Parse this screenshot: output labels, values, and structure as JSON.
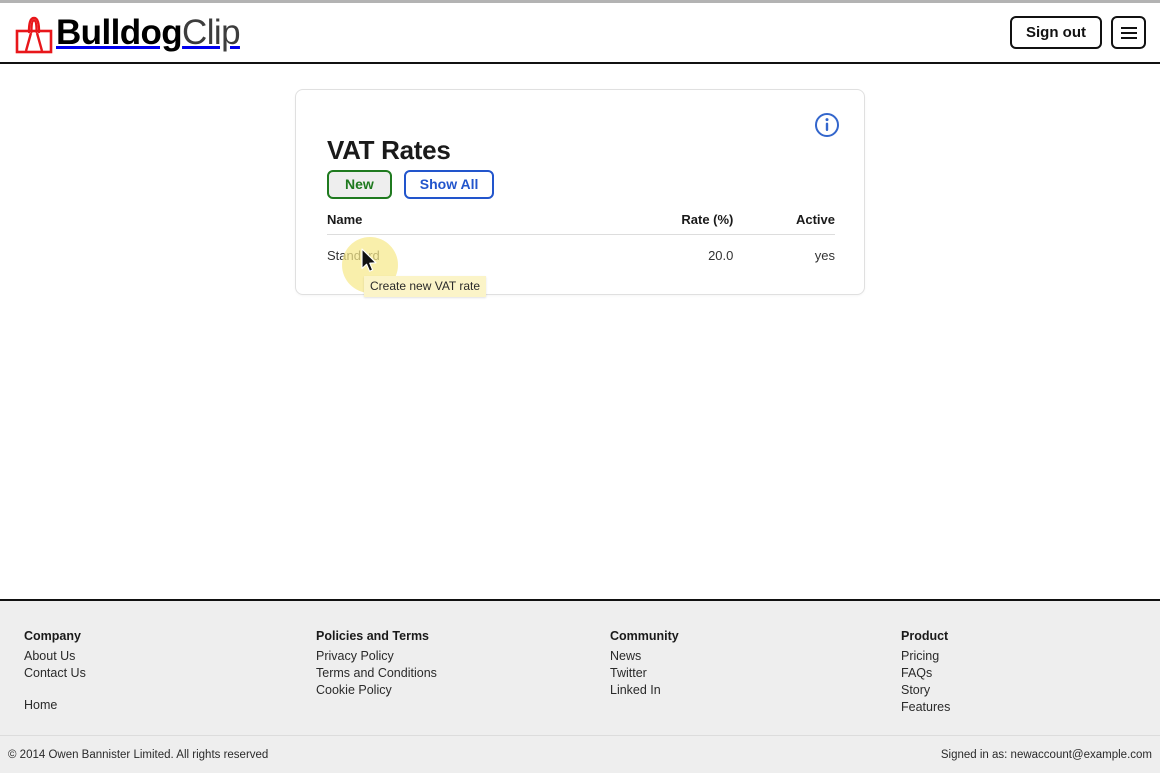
{
  "browser": {
    "top_edge": ""
  },
  "header": {
    "brand": {
      "icon": "bulldog-clip-icon",
      "name_bold": "Bulldog",
      "name_light": "Clip",
      "icon_color": "#e8161a"
    },
    "sign_out_label": "Sign out",
    "menu_icon": "hamburger-menu-icon"
  },
  "card": {
    "title": "VAT Rates",
    "info_icon": "info-circle-icon",
    "info_icon_color": "#3366cc",
    "buttons": {
      "new_label": "New",
      "new_color": "#1f7a1f",
      "show_all_label": "Show All",
      "show_all_color": "#2255cc"
    },
    "table": {
      "headers": [
        "Name",
        "Rate (%)",
        "Active"
      ],
      "rows": [
        {
          "name": "Standard",
          "rate": "20.0",
          "active": "yes"
        }
      ]
    }
  },
  "cursor": {
    "tooltip": "Create new VAT rate",
    "tooltip_bg": "#fbf4c8",
    "halo_color": "#f7e98a"
  },
  "footer": {
    "columns": [
      {
        "heading": "Company",
        "links": [
          "About Us",
          "Contact Us"
        ],
        "extra_links": [
          "Home"
        ]
      },
      {
        "heading": "Policies and Terms",
        "links": [
          "Privacy Policy",
          "Terms and Conditions",
          "Cookie Policy"
        ],
        "extra_links": []
      },
      {
        "heading": "Community",
        "links": [
          "News",
          "Twitter",
          "Linked In"
        ],
        "extra_links": []
      },
      {
        "heading": "Product",
        "links": [
          "Pricing",
          "FAQs",
          "Story",
          "Features"
        ],
        "extra_links": []
      }
    ],
    "copyright": "© 2014 Owen Bannister Limited. All rights reserved",
    "signed_in": "Signed in as: newaccount@example.com"
  }
}
